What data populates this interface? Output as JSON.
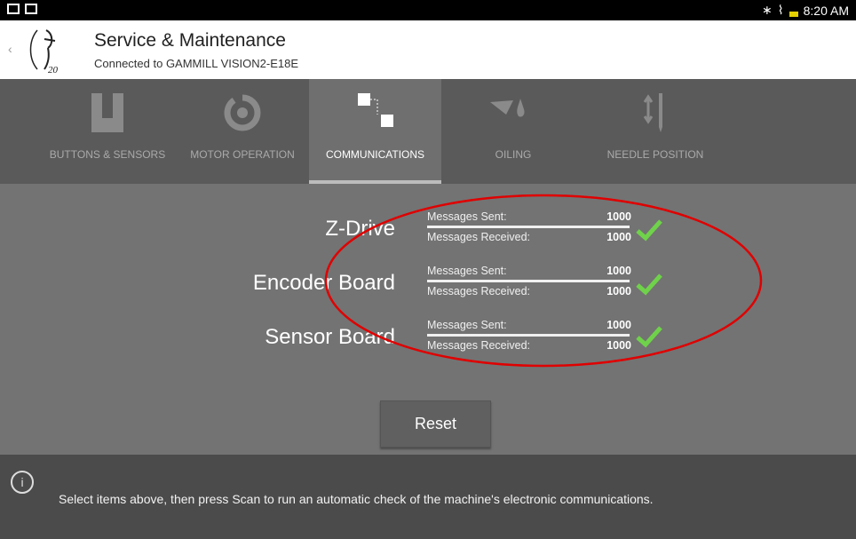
{
  "statusbar": {
    "time": "8:20 AM",
    "icons": [
      "gallery-icon",
      "cast-icon",
      "bluetooth-icon",
      "wifi-icon",
      "battery-icon"
    ]
  },
  "header": {
    "back_icon": "chevron-left-icon",
    "title": "Service & Maintenance",
    "subtitle": "Connected to GAMMILL VISION2-E18E"
  },
  "tabs": [
    {
      "label": "BUTTONS & SENSORS",
      "icon": "buttons-sensors-icon",
      "active": false
    },
    {
      "label": "MOTOR OPERATION",
      "icon": "motor-operation-icon",
      "active": false
    },
    {
      "label": "COMMUNICATIONS",
      "icon": "communications-icon",
      "active": true
    },
    {
      "label": "OILING",
      "icon": "oiling-icon",
      "active": false
    },
    {
      "label": "NEEDLE POSITION",
      "icon": "needle-position-icon",
      "active": false
    }
  ],
  "devices": [
    {
      "name": "Z-Drive",
      "sent_label": "Messages Sent:",
      "sent": "1000",
      "received_label": "Messages Received:",
      "received": "1000",
      "status": "ok"
    },
    {
      "name": "Encoder Board",
      "sent_label": "Messages Sent:",
      "sent": "1000",
      "received_label": "Messages Received:",
      "received": "1000",
      "status": "ok"
    },
    {
      "name": "Sensor Board",
      "sent_label": "Messages Sent:",
      "sent": "1000",
      "received_label": "Messages Received:",
      "received": "1000",
      "status": "ok"
    }
  ],
  "reset_label": "Reset",
  "footer": {
    "info_icon": "info-icon",
    "text": "Select items above, then press Scan to run an automatic check of the machine's electronic communications."
  },
  "colors": {
    "check": "#6fd24a",
    "annotation": "#e00000",
    "active_tab": "#6f6f6f"
  }
}
